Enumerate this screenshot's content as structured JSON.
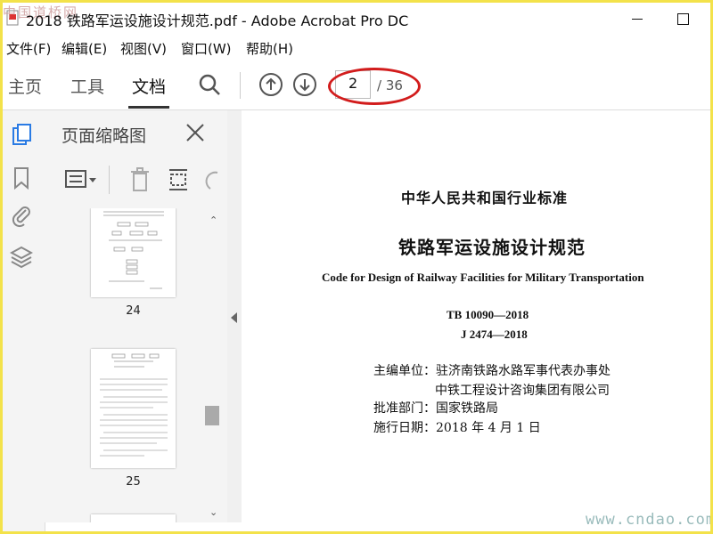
{
  "window": {
    "title": "2018 铁路军运设施设计规范.pdf - Adobe Acrobat Pro DC"
  },
  "watermarks": {
    "top_left": "中国道桥网",
    "bottom_right": "www.cndao.com"
  },
  "menu": {
    "items": [
      "文件(F)",
      "编辑(E)",
      "视图(V)",
      "窗口(W)",
      "帮助(H)"
    ]
  },
  "toolbar": {
    "tabs": [
      "主页",
      "工具",
      "文档"
    ],
    "active_tab": "文档",
    "current_page": "2",
    "total_pages": "/ 36"
  },
  "panel": {
    "title": "页面缩略图",
    "thumbnails": [
      {
        "label": "24"
      },
      {
        "label": "25"
      }
    ]
  },
  "document": {
    "category": "中华人民共和国行业标准",
    "title": "铁路军运设施设计规范",
    "english_title": "Code for Design of Railway Facilities for Military Transportation",
    "code_tb": "TB 10090—2018",
    "code_j": "J 2474—2018",
    "editor_line1": "主编单位：驻济南铁路水路军事代表办事处",
    "editor_line2": "中铁工程设计咨询集团有限公司",
    "approval": "批准部门：国家铁路局",
    "effective": "施行日期：2018 年 4 月 1 日"
  },
  "colors": {
    "highlight_ellipse": "#d21c1c",
    "frame": "#f3e24a"
  }
}
